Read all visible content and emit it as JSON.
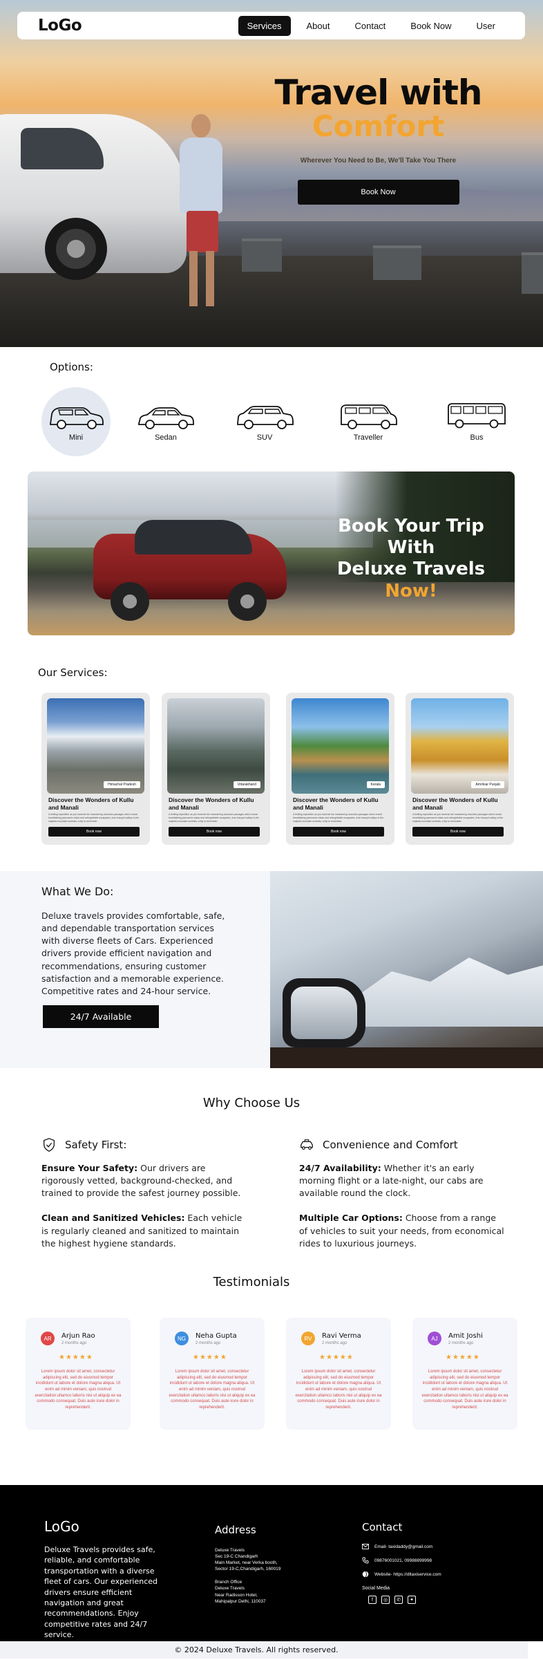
{
  "nav": {
    "logo": "LoGo",
    "links": [
      "Services",
      "About",
      "Contact",
      "Book Now",
      "User"
    ]
  },
  "hero": {
    "title_line1": "Travel with",
    "title_line2": "Comfort",
    "tagline": "Wherever You Need to Be, We'll Take You There",
    "cta": "Book Now"
  },
  "options": {
    "label": "Options:",
    "items": [
      "Mini",
      "Sedan",
      "SUV",
      "Traveller",
      "Bus"
    ]
  },
  "banner": {
    "line1": "Book Your Trip With",
    "line2": "Deluxe Travels",
    "highlight": "Now!"
  },
  "services": {
    "label": "Our Services:",
    "cards": [
      {
        "title": "Discover the Wonders of Kullu and Manali",
        "tag": "Himachal Pradesh",
        "desc": "A thrilling expedition as you traverse the meandering mountain passages which reveal breathtaking panoramic vistas and unforgettable escapades, from tranquil valleys to the majestic mountain summits, a trip to remember.",
        "button": "Book now"
      },
      {
        "title": "Discover the Wonders of Kullu and Manali",
        "tag": "Uttarakhand",
        "desc": "A thrilling expedition as you traverse the meandering mountain passages which reveal breathtaking panoramic vistas and unforgettable escapades, from tranquil valleys to the majestic mountain summits, a trip to remember.",
        "button": "Book now"
      },
      {
        "title": "Discover the Wonders of Kullu and Manali",
        "tag": "Kerala",
        "desc": "A thrilling expedition as you traverse the meandering mountain passages which reveal breathtaking panoramic vistas and unforgettable escapades, from tranquil valleys to the majestic mountain summits, a trip to remember.",
        "button": "Book now"
      },
      {
        "title": "Discover the Wonders of Kullu and Manali",
        "tag": "Amritsar Punjab",
        "desc": "A thrilling expedition as you traverse the meandering mountain passages which reveal breathtaking panoramic vistas and unforgettable escapades, from tranquil valleys to the majestic mountain summits, a trip to remember.",
        "button": "Book now"
      }
    ]
  },
  "what_we_do": {
    "title": "What We Do:",
    "text": "Deluxe travels provides comfortable, safe, and dependable transportation services with diverse fleets of Cars. Experienced drivers provide efficient navigation and recommendations, ensuring customer satisfaction and a memorable experience. Competitive rates and 24-hour service.",
    "button": "24/7 Available"
  },
  "why": {
    "title": "Why Choose Us",
    "left": {
      "heading": "Safety First:",
      "p1_bold": "Ensure Your Safety:",
      "p1": " Our drivers are rigorously vetted, background-checked, and trained to provide the safest journey possible.",
      "p2_bold": "Clean and Sanitized Vehicles:",
      "p2": " Each vehicle is regularly cleaned and sanitized to maintain the highest hygiene standards."
    },
    "right": {
      "heading": "Convenience and Comfort",
      "p1_bold": "24/7 Availability:",
      "p1": " Whether it's an early morning flight or a late-night, our cabs are available round the clock.",
      "p2_bold": "Multiple Car Options:",
      "p2": " Choose from a range of vehicles to suit your needs, from economical rides to luxurious journeys."
    }
  },
  "testimonials": {
    "title": "Testimonials",
    "items": [
      {
        "initials": "AR",
        "name": "Arjun Rao",
        "time": "2 months ago",
        "stars": "★★★★★",
        "text": "Lorem ipsum dolor sit amet, consectetur adipiscing elit, sed do eiusmod tempor incididunt ut labore et dolore magna aliqua. Ut enim ad minim veniam, quis nostrud exercitation ullamco laboris nisi ut aliquip ex ea commodo consequat. Duis aute irure dolor in reprehenderit.",
        "color": "#e04747"
      },
      {
        "initials": "NG",
        "name": "Neha Gupta",
        "time": "2 months ago",
        "stars": "★★★★★",
        "text": "Lorem ipsum dolor sit amet, consectetur adipiscing elit, sed do eiusmod tempor incididunt ut labore et dolore magna aliqua. Ut enim ad minim veniam, quis nostrud exercitation ullamco laboris nisi ut aliquip ex ea commodo consequat. Duis aute irure dolor in reprehenderit.",
        "color": "#3f8ee0"
      },
      {
        "initials": "RV",
        "name": "Ravi Verma",
        "time": "2 months ago",
        "stars": "★★★★★",
        "text": "Lorem ipsum dolor sit amet, consectetur adipiscing elit, sed do eiusmod tempor incididunt ut labore et dolore magna aliqua. Ut enim ad minim veniam, quis nostrud exercitation ullamco laboris nisi ut aliquip ex ea commodo consequat. Duis aute irure dolor in reprehenderit.",
        "color": "#f2a531"
      },
      {
        "initials": "AJ",
        "name": "Amit Joshi",
        "time": "2 months ago",
        "stars": "★★★★★",
        "text": "Lorem ipsum dolor sit amet, consectetur adipiscing elit, sed do eiusmod tempor incididunt ut labore et dolore magna aliqua. Ut enim ad minim veniam, quis nostrud exercitation ullamco laboris nisi ut aliquip ex ea commodo consequat. Duis aute irure dolor in reprehenderit.",
        "color": "#a04fd6"
      }
    ]
  },
  "footer": {
    "logo": "LoGo",
    "about": "Deluxe Travels provides safe, reliable, and comfortable transportation with a diverse fleet of cars. Our experienced drivers ensure efficient navigation and great recommendations. Enjoy competitive rates and 24/7 service.",
    "address_title": "Address",
    "address1": [
      "Deluxe Travels",
      "Sec 19-C Chandigarh",
      "Main Market, near Verka booth,",
      "Sector 19-C,Chandigarh, 160019"
    ],
    "address2": [
      "Branch Office",
      "Deluxe Travels",
      "Near Radisson Hotel,",
      "Mahipalpur Delhi, 110037"
    ],
    "contact_title": "Contact",
    "email": "Email- taxidaddy@gmail.com",
    "phone": "09876001021, 09988899998",
    "website": "Website- https://dltaxiservice.com",
    "social_label": "Social Media",
    "copyright": "© 2024 Deluxe Travels. All rights reserved."
  }
}
